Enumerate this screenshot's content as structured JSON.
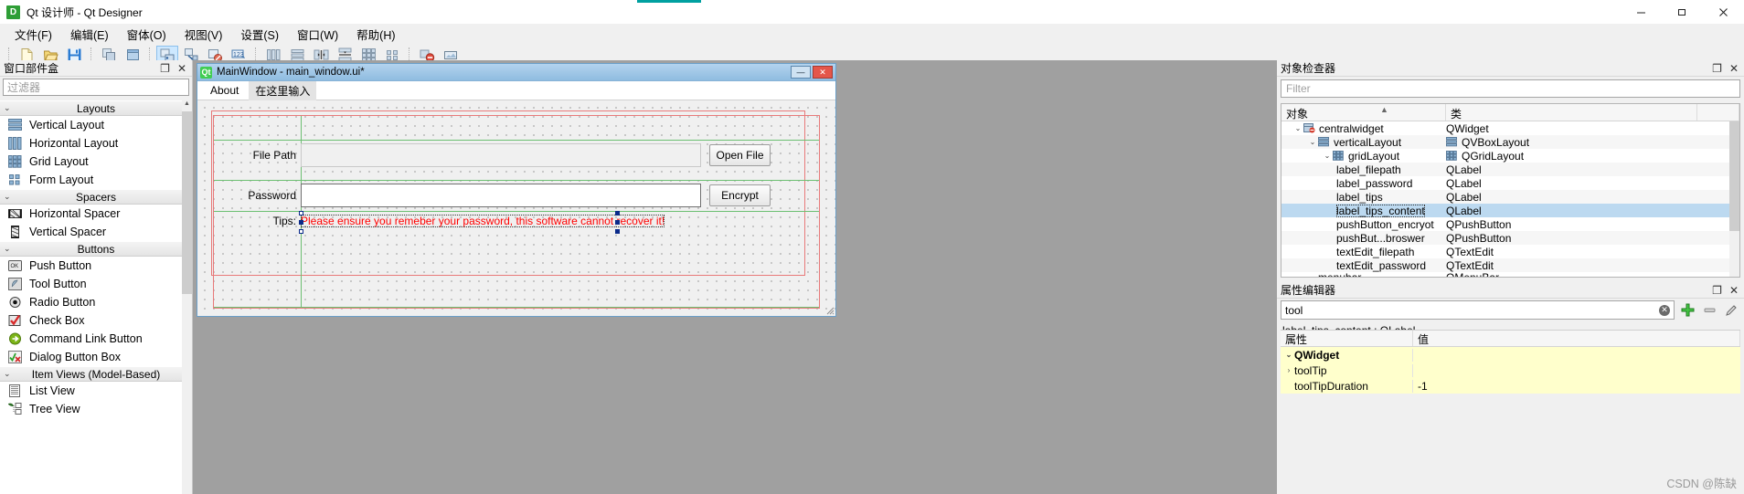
{
  "titlebar": {
    "logo_text": "D",
    "title": "Qt 设计师 - Qt Designer",
    "minimize": "—",
    "maximize": "❐",
    "close": "✕"
  },
  "menubar": {
    "items": [
      {
        "label": "文件(F)"
      },
      {
        "label": "编辑(E)"
      },
      {
        "label": "窗体(O)"
      },
      {
        "label": "视图(V)"
      },
      {
        "label": "设置(S)"
      },
      {
        "label": "窗口(W)"
      },
      {
        "label": "帮助(H)"
      }
    ]
  },
  "toolbar": {
    "groups": [
      [
        "new-form-icon",
        "open-form-icon",
        "save-form-icon"
      ],
      [
        "edit-widgets-icon",
        "edit-widgets-alt-icon"
      ],
      [
        "edit-signals-slots-icon",
        "edit-buddies-icon",
        "edit-tab-order-icon",
        "edit-numbers-icon"
      ],
      [
        "layout-horizontally-icon",
        "layout-vertically-icon",
        "layout-splitter-h-icon",
        "layout-splitter-v-icon",
        "layout-grid-icon",
        "layout-form-icon"
      ],
      [
        "break-layout-icon",
        "adjust-size-icon"
      ]
    ]
  },
  "widget_box": {
    "title": "窗口部件盒",
    "dock_float": "❐",
    "dock_close": "✕",
    "filter_placeholder": "过滤器",
    "groups": [
      {
        "name": "Layouts",
        "items": [
          {
            "label": "Vertical Layout",
            "icon": "vertical-layout-icon"
          },
          {
            "label": "Horizontal Layout",
            "icon": "horizontal-layout-icon"
          },
          {
            "label": "Grid Layout",
            "icon": "grid-layout-icon"
          },
          {
            "label": "Form Layout",
            "icon": "form-layout-icon"
          }
        ]
      },
      {
        "name": "Spacers",
        "items": [
          {
            "label": "Horizontal Spacer",
            "icon": "horizontal-spacer-icon"
          },
          {
            "label": "Vertical Spacer",
            "icon": "vertical-spacer-icon"
          }
        ]
      },
      {
        "name": "Buttons",
        "items": [
          {
            "label": "Push Button",
            "icon": "push-button-icon"
          },
          {
            "label": "Tool Button",
            "icon": "tool-button-icon"
          },
          {
            "label": "Radio Button",
            "icon": "radio-button-icon"
          },
          {
            "label": "Check Box",
            "icon": "check-box-icon"
          },
          {
            "label": "Command Link Button",
            "icon": "command-link-button-icon"
          },
          {
            "label": "Dialog Button Box",
            "icon": "dialog-button-box-icon"
          }
        ]
      },
      {
        "name": "Item Views (Model-Based)",
        "items": [
          {
            "label": "List View",
            "icon": "list-view-icon"
          },
          {
            "label": "Tree View",
            "icon": "tree-view-icon"
          }
        ]
      }
    ]
  },
  "form_window": {
    "qt_badge": "Qt",
    "title": "MainWindow - main_window.ui*",
    "window_buttons": {
      "minimize": "—",
      "maximize": "❐",
      "close": "✕"
    },
    "menus": [
      {
        "label": "About",
        "placeholder": false
      },
      {
        "label": "在这里输入",
        "placeholder": true
      }
    ],
    "rows": [
      {
        "label": "File Path",
        "field_value": "",
        "button": "Open File"
      },
      {
        "label": "Password",
        "field_value": "",
        "button": "Encrypt"
      },
      {
        "label": "Tips:",
        "tips_text": "Please ensure you remeber your password, this software cannot recover it!"
      }
    ]
  },
  "object_inspector": {
    "title": "对象检查器",
    "dock_float": "❐",
    "dock_close": "✕",
    "filter_placeholder": "Filter",
    "columns": [
      "对象",
      "类"
    ],
    "rows": [
      {
        "name": "centralwidget",
        "class": "QWidget",
        "indent": 1,
        "chev": "⌄",
        "icon": "widget-icon",
        "selected": false
      },
      {
        "name": "verticalLayout",
        "class": "QVBoxLayout",
        "indent": 2,
        "chev": "⌄",
        "icon": "vbox-layout-icon",
        "class_icon": "vbox-layout-icon",
        "selected": false
      },
      {
        "name": "gridLayout",
        "class": "QGridLayout",
        "indent": 3,
        "chev": "⌄",
        "icon": "grid-layout-icon",
        "class_icon": "grid-layout-icon",
        "selected": false
      },
      {
        "name": "label_filepath",
        "class": "QLabel",
        "indent": 4,
        "chev": "",
        "icon": "",
        "selected": false
      },
      {
        "name": "label_password",
        "class": "QLabel",
        "indent": 4,
        "chev": "",
        "icon": "",
        "selected": false
      },
      {
        "name": "label_tips",
        "class": "QLabel",
        "indent": 4,
        "chev": "",
        "icon": "",
        "selected": false
      },
      {
        "name": "label_tips_content",
        "class": "QLabel",
        "indent": 4,
        "chev": "",
        "icon": "",
        "selected": true
      },
      {
        "name": "pushButton_encryot",
        "class": "QPushButton",
        "indent": 4,
        "chev": "",
        "icon": "",
        "selected": false
      },
      {
        "name": "pushBut...broswer",
        "class": "QPushButton",
        "indent": 4,
        "chev": "",
        "icon": "",
        "selected": false
      },
      {
        "name": "textEdit_filepath",
        "class": "QTextEdit",
        "indent": 4,
        "chev": "",
        "icon": "",
        "selected": false
      },
      {
        "name": "textEdit_password",
        "class": "QTextEdit",
        "indent": 4,
        "chev": "",
        "icon": "",
        "selected": false
      },
      {
        "name": "menubar",
        "class": "QMenuBar",
        "indent": 2,
        "chev": "⌄",
        "icon": "",
        "selected": false
      }
    ]
  },
  "property_editor": {
    "title": "属性编辑器",
    "dock_float": "❐",
    "dock_close": "✕",
    "filter_value": "tool",
    "clear_icon": "✕",
    "add_icon": "+",
    "remove_icon": "—",
    "configure_icon": "✎",
    "subtitle": "label_tips_content : QLabel",
    "columns": [
      "属性",
      "值"
    ],
    "rows": [
      {
        "name": "QWidget",
        "value": "",
        "group": true,
        "chev": "⌄"
      },
      {
        "name": "toolTip",
        "value": "",
        "group": false,
        "chev": "›"
      },
      {
        "name": "toolTipDuration",
        "value": "-1",
        "group": false,
        "chev": ""
      }
    ]
  },
  "watermark": "CSDN @陈缺"
}
